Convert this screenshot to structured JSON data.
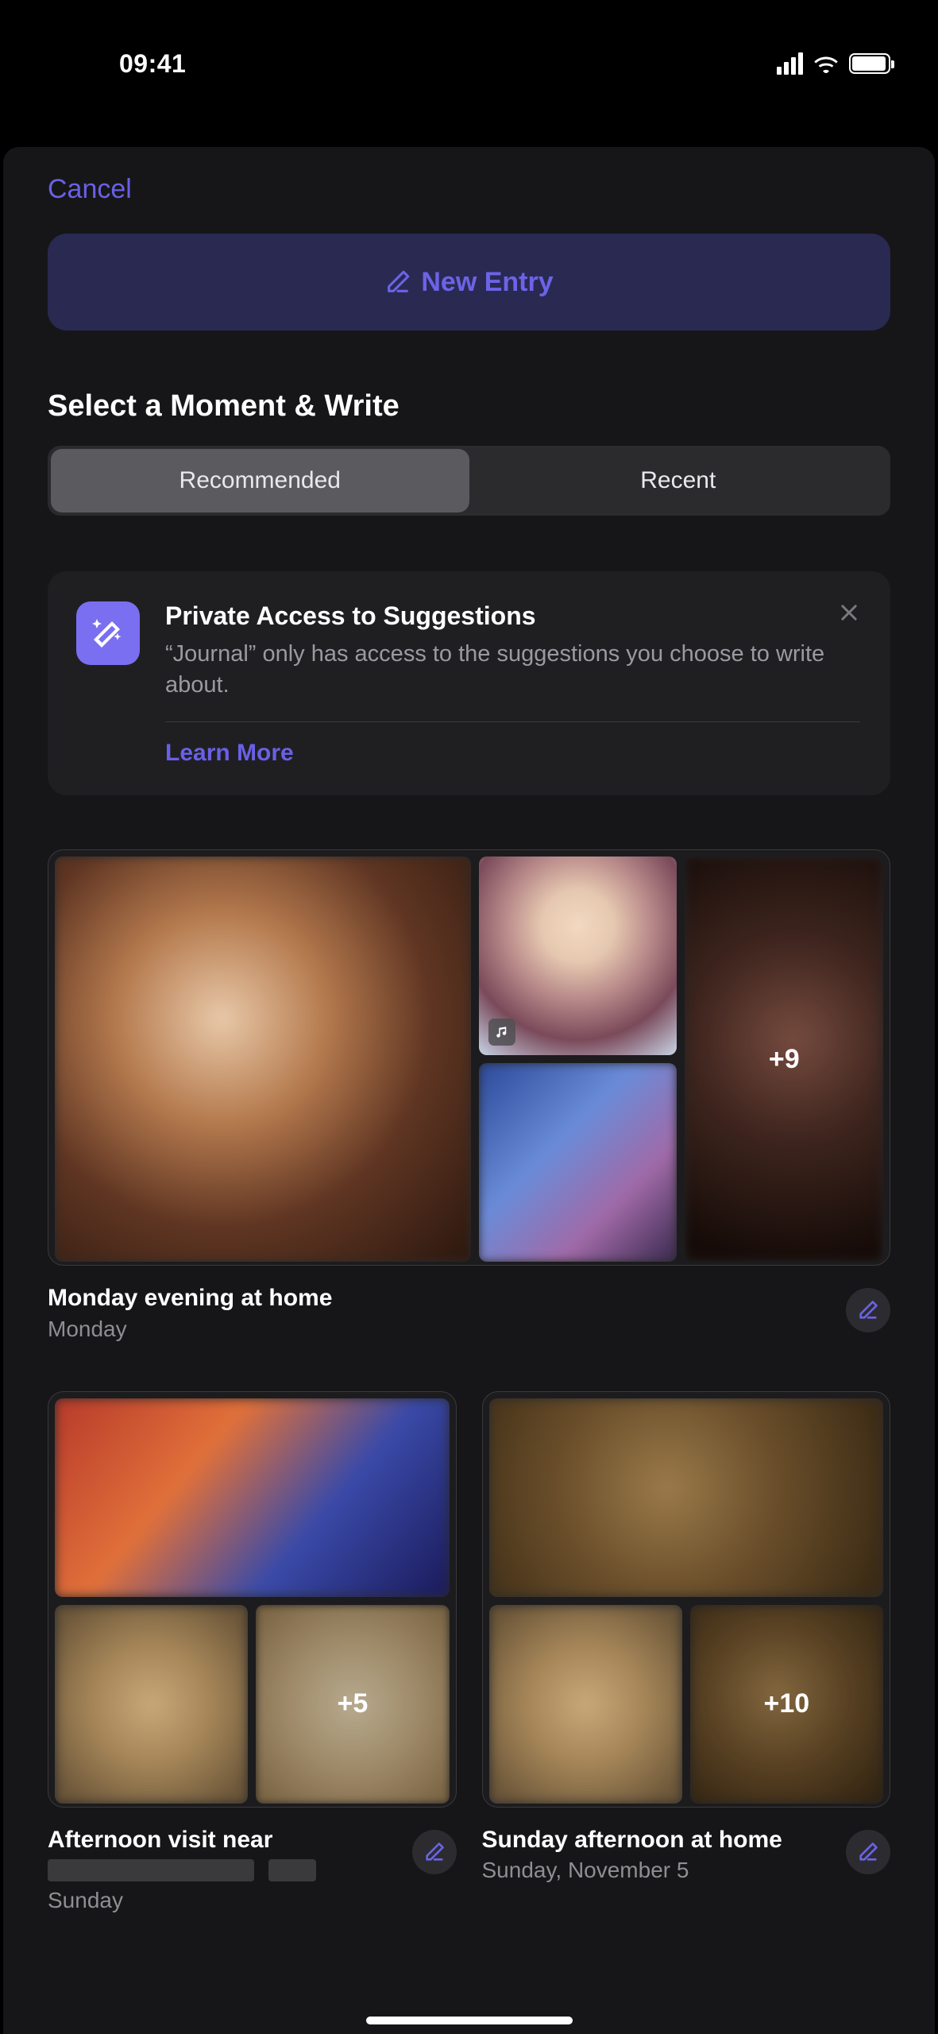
{
  "status": {
    "time": "09:41"
  },
  "header": {
    "cancel": "Cancel",
    "new_entry": "New Entry"
  },
  "section_title": "Select a Moment & Write",
  "tabs": {
    "recommended": "Recommended",
    "recent": "Recent",
    "active": "recommended"
  },
  "privacy": {
    "title": "Private Access to Suggestions",
    "body": "“Journal” only has access to the suggestions you choose to write about.",
    "learn_more": "Learn More"
  },
  "moments": [
    {
      "title": "Monday evening at home",
      "subtitle": "Monday",
      "more_count": "+9",
      "has_music": true
    },
    {
      "title": "Afternoon visit near",
      "subtitle": "Sunday",
      "more_count": "+5",
      "title_redacted_suffix": true
    },
    {
      "title": "Sunday afternoon at home",
      "subtitle": "Sunday, November 5",
      "more_count": "+10"
    }
  ]
}
